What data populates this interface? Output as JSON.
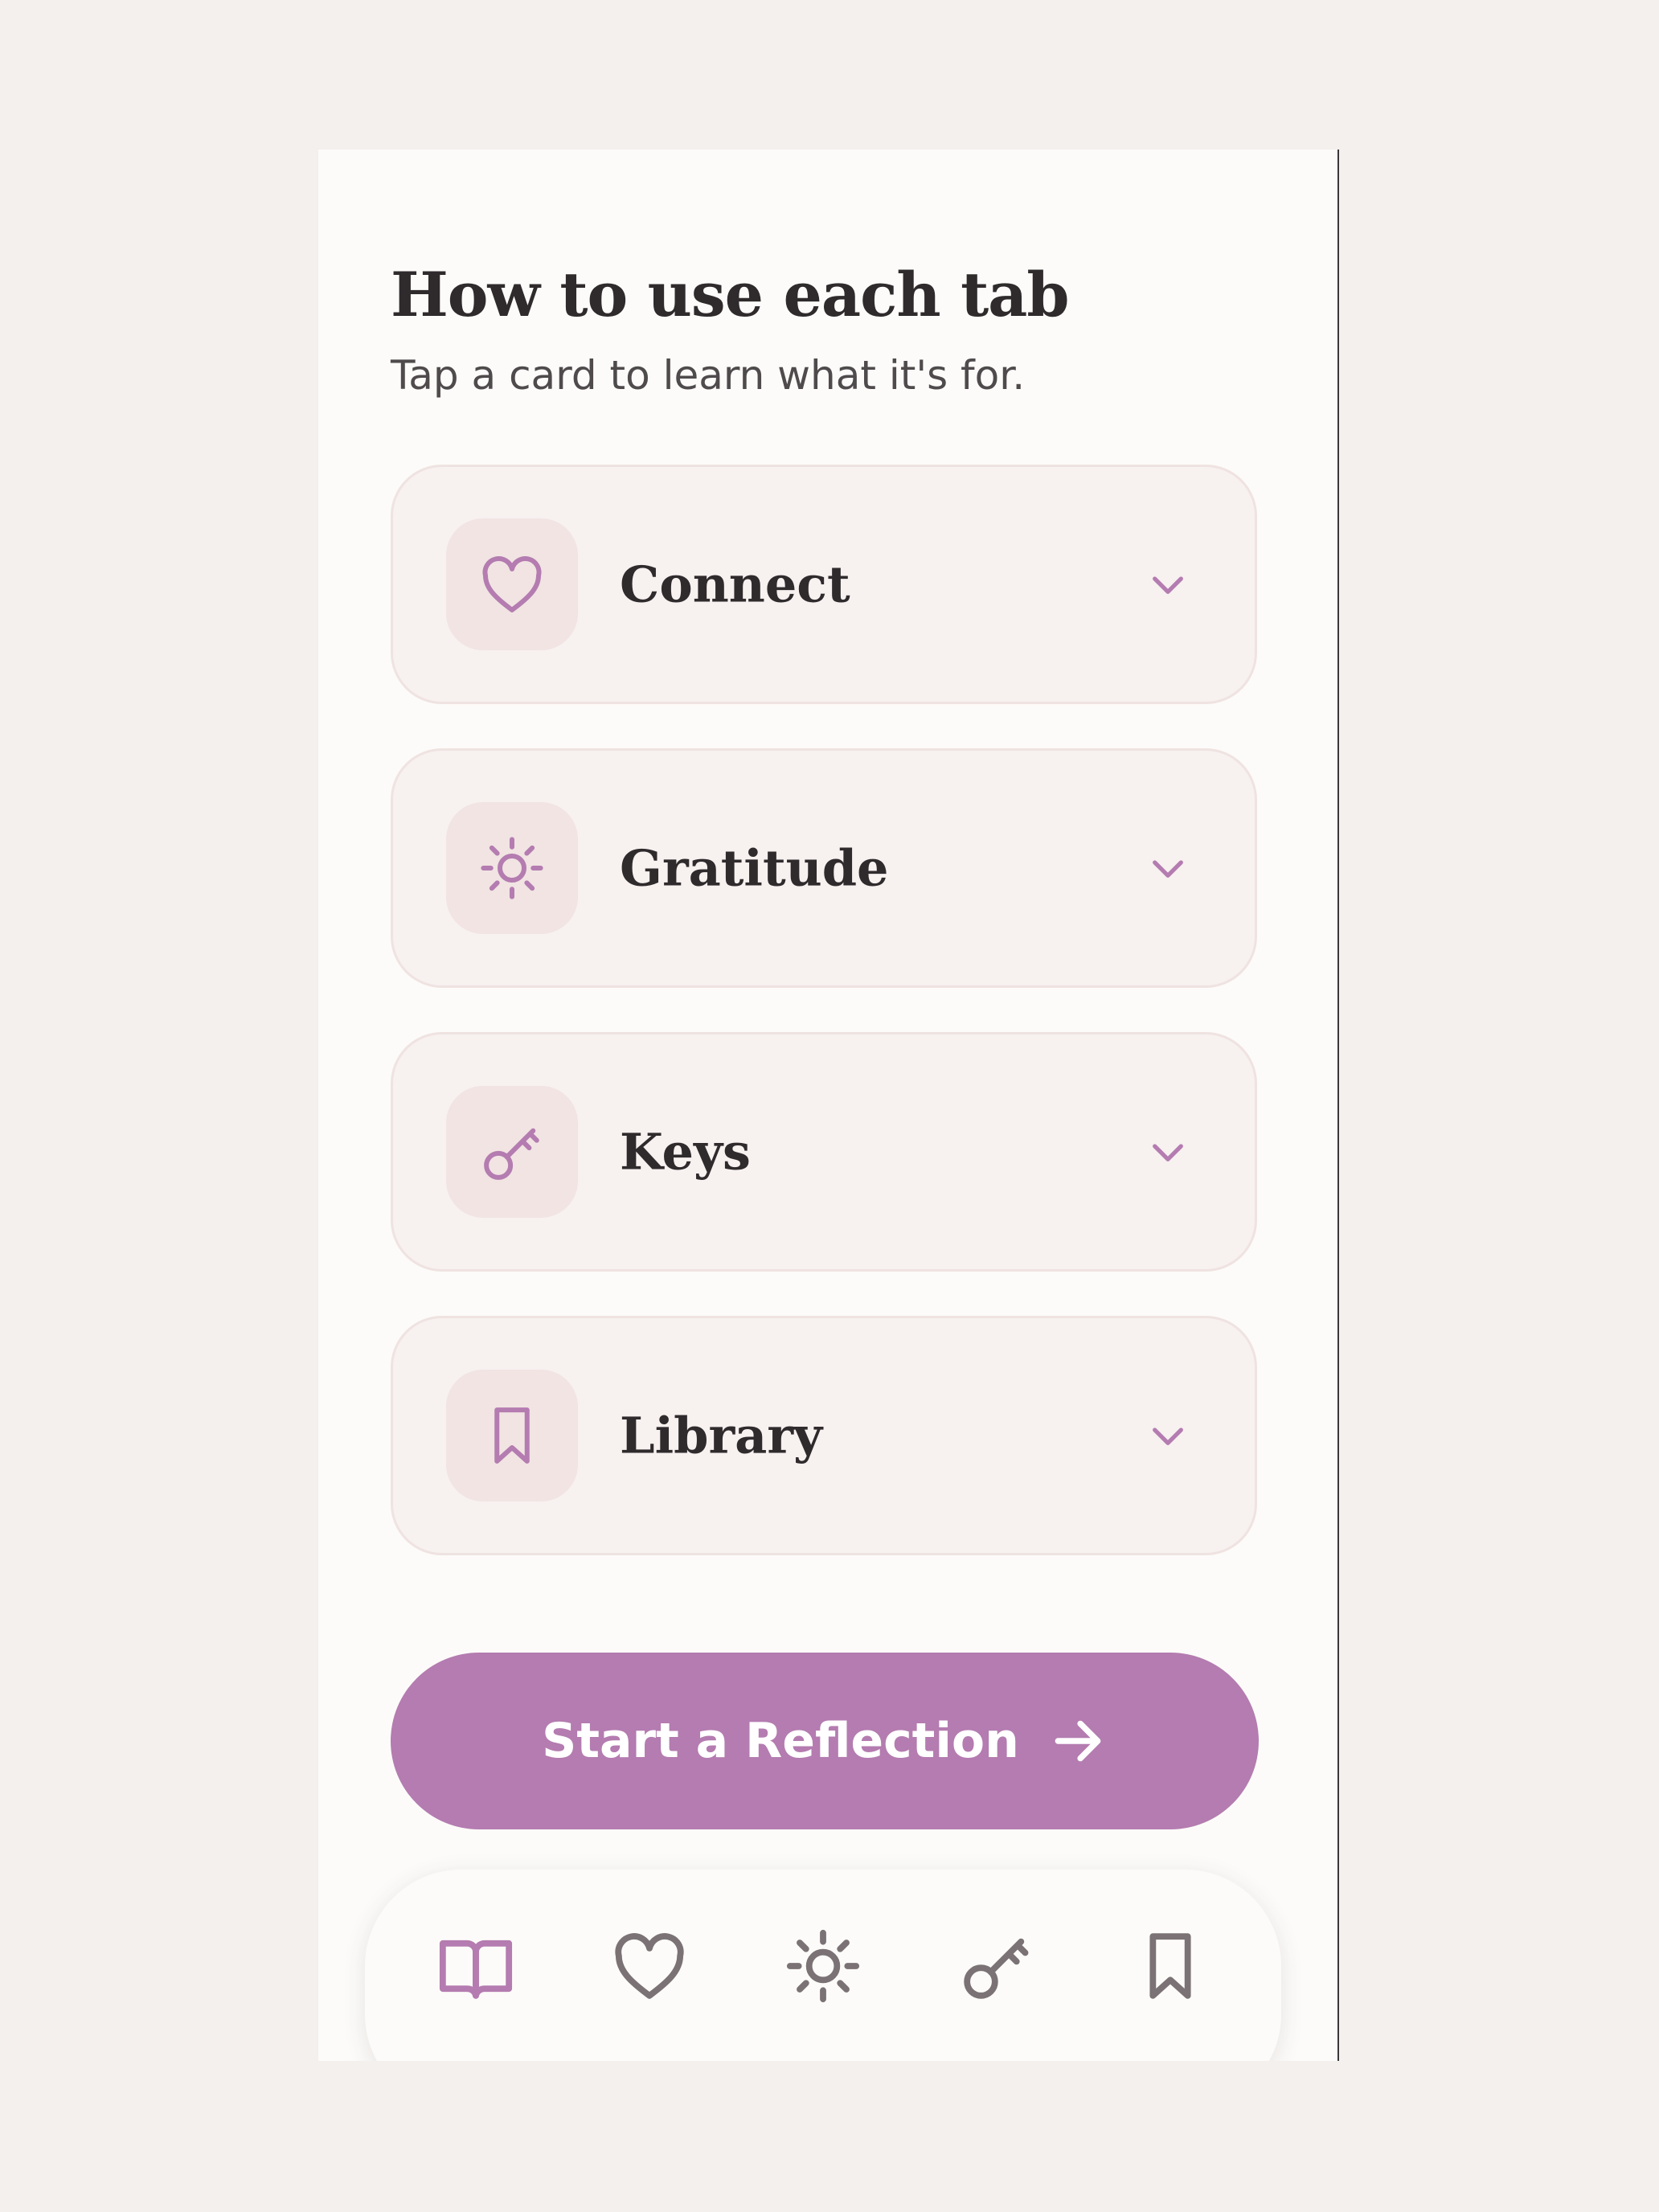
{
  "header": {
    "title": "How to use each tab",
    "subtitle": "Tap a card to learn what it's for."
  },
  "cards": [
    {
      "label": "Connect",
      "icon": "heart-icon"
    },
    {
      "label": "Gratitude",
      "icon": "sun-icon"
    },
    {
      "label": "Keys",
      "icon": "key-icon"
    },
    {
      "label": "Library",
      "icon": "bookmark-icon"
    }
  ],
  "cta": {
    "label": "Start a Reflection",
    "icon": "arrow-right-icon"
  },
  "tabbar": {
    "tabs": [
      {
        "icon": "book-icon",
        "active": true
      },
      {
        "icon": "heart-icon",
        "active": false
      },
      {
        "icon": "sun-icon",
        "active": false
      },
      {
        "icon": "key-icon",
        "active": false
      },
      {
        "icon": "bookmark-icon",
        "active": false
      }
    ]
  },
  "colors": {
    "accent": "#b47cb0",
    "card_background": "#f7f1f0",
    "icon_tile": "#f1e4e3",
    "text": "#2f2a2c",
    "inactive_icon": "#7a7274",
    "page_background": "#fcfbf9"
  }
}
